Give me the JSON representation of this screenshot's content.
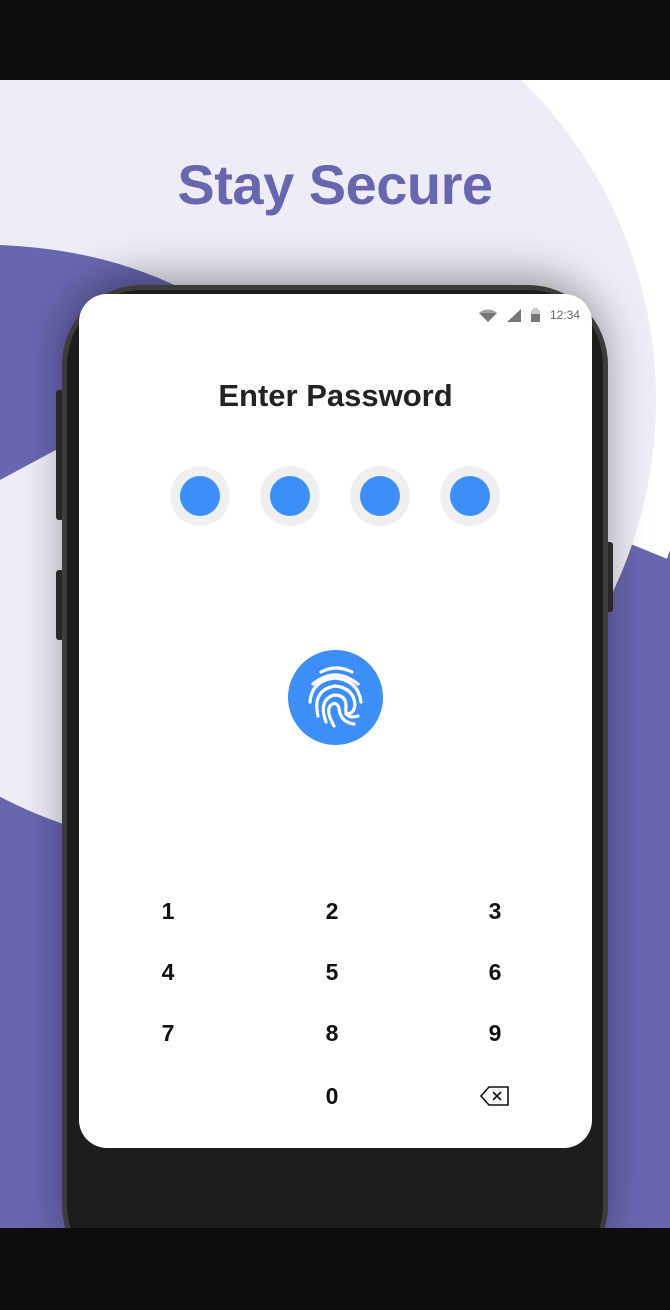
{
  "headline": "Stay Secure",
  "status_bar": {
    "time": "12:34",
    "icons": [
      "wifi-icon",
      "signal-icon",
      "battery-icon"
    ]
  },
  "lock_screen": {
    "title": "Enter Password",
    "pin_dots_filled": 4,
    "pin_dots_total": 4,
    "fingerprint_icon": "fingerprint-icon",
    "keys": [
      "1",
      "2",
      "3",
      "4",
      "5",
      "6",
      "7",
      "8",
      "9",
      "0"
    ],
    "backspace_icon": "backspace-icon"
  },
  "colors": {
    "accent": "#6866ae",
    "lavender": "#ededf7",
    "blue": "#3d8ef7",
    "phone": "#1c1d1d"
  }
}
